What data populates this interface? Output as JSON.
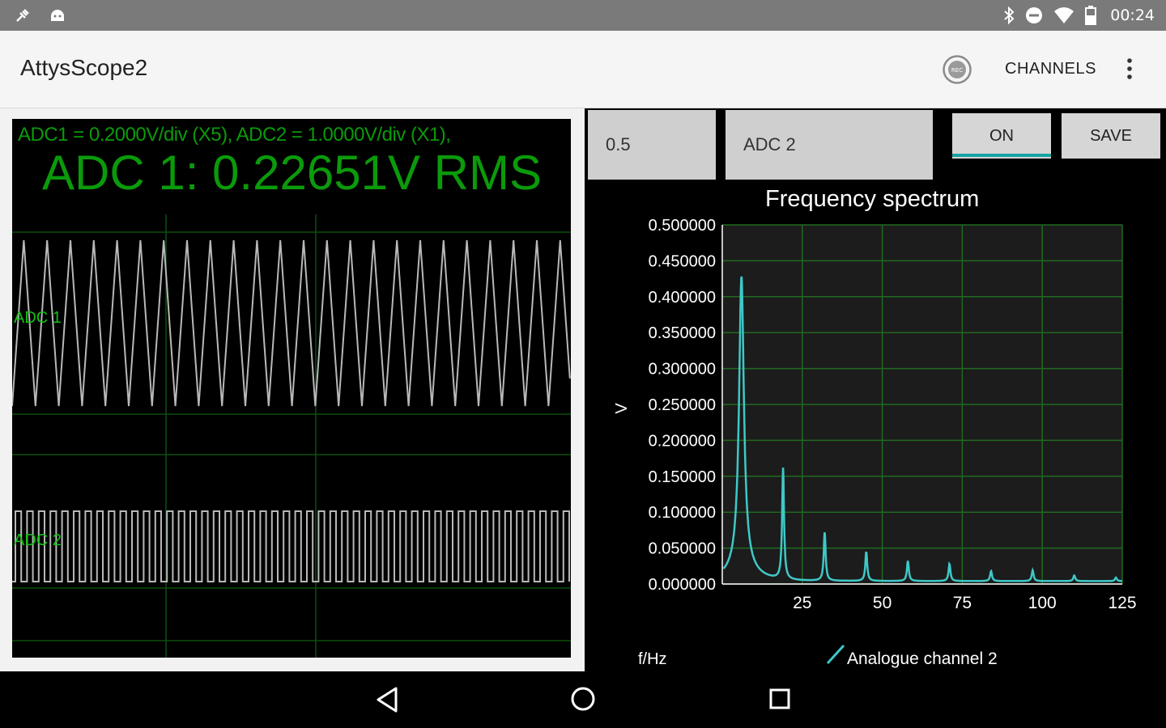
{
  "status_bar": {
    "time": "00:24",
    "left_icons": [
      "plug-icon",
      "android-icon"
    ],
    "right_icons": [
      "bluetooth-icon",
      "do-not-disturb-icon",
      "wifi-icon",
      "battery-icon"
    ]
  },
  "app_bar": {
    "title": "AttysScope2",
    "rec_label": "REC",
    "channels_label": "CHANNELS",
    "overflow_icon": "more-vert-icon"
  },
  "scope": {
    "gain_info": "ADC1 = 0.2000V/div (X5), ADC2 = 1.0000V/div (X1),",
    "rms_readout": "ADC 1: 0.22651V RMS",
    "trace1_label": "ADC 1",
    "trace2_label": "ADC 2",
    "trace_color": "#b8b8b8",
    "grid_color": "#0d4f0d",
    "text_color": "#0b9a0b"
  },
  "spectrum_controls": {
    "max_value": "0.5",
    "channel": "ADC 2",
    "on_label": "ON",
    "save_label": "SAVE"
  },
  "chart_data": {
    "type": "line",
    "title": "Frequency spectrum",
    "xlabel": "f/Hz",
    "ylabel": "V",
    "xlim": [
      0,
      125
    ],
    "ylim": [
      0,
      0.5
    ],
    "x_ticks": [
      25,
      50,
      75,
      100,
      125
    ],
    "x_tick_labels": [
      "25",
      "50",
      "75",
      "100",
      "125"
    ],
    "y_ticks": [
      0,
      0.05,
      0.1,
      0.15,
      0.2,
      0.25,
      0.3,
      0.35,
      0.4,
      0.45,
      0.5
    ],
    "y_tick_labels": [
      "0.000000",
      "0.050000",
      "0.100000",
      "0.150000",
      "0.200000",
      "0.250000",
      "0.300000",
      "0.350000",
      "0.400000",
      "0.450000",
      "0.500000"
    ],
    "grid": true,
    "legend_placement": "bottom",
    "series": [
      {
        "name": "Analogue channel 2",
        "color": "#3fc8c8",
        "peaks": [
          {
            "f": 6,
            "v": 0.395
          },
          {
            "f": 19,
            "v": 0.155
          },
          {
            "f": 32,
            "v": 0.068
          },
          {
            "f": 45,
            "v": 0.041
          },
          {
            "f": 58,
            "v": 0.028
          },
          {
            "f": 71,
            "v": 0.024
          },
          {
            "f": 84,
            "v": 0.014
          },
          {
            "f": 97,
            "v": 0.015
          },
          {
            "f": 110,
            "v": 0.008
          },
          {
            "f": 123,
            "v": 0.005
          }
        ]
      }
    ]
  },
  "nav_bar": {
    "icons": [
      "back-icon",
      "home-icon",
      "recents-icon"
    ]
  }
}
